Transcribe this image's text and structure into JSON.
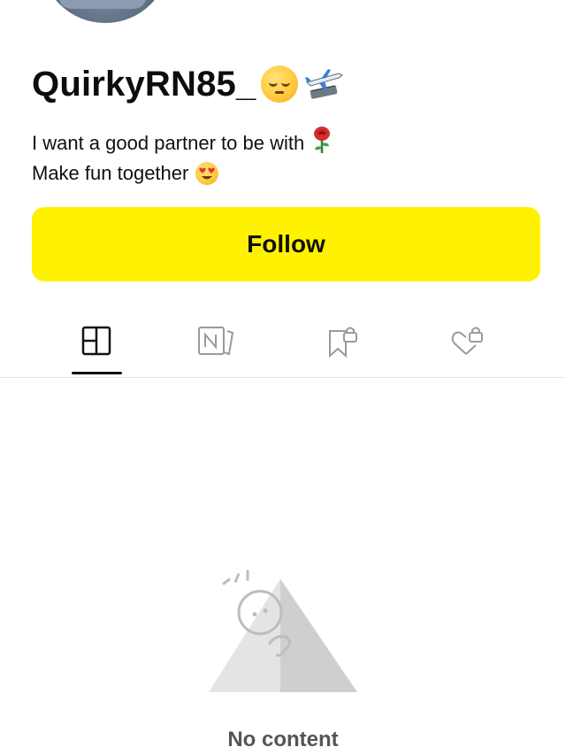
{
  "profile": {
    "username": "QuirkyRN85_",
    "username_emojis": [
      "pensive-face-emoji",
      "airplane-emoji"
    ],
    "bio_line1": "I want a good partner to be with",
    "bio_line1_emoji": "rose-emoji",
    "bio_line2": "Make fun together",
    "bio_line2_emoji": "heart-eyes-emoji"
  },
  "follow_button": {
    "label": "Follow",
    "color": "#fff200"
  },
  "tabs": [
    {
      "icon": "grid-icon",
      "active": true
    },
    {
      "icon": "notes-icon",
      "active": false
    },
    {
      "icon": "locked-bookmark-icon",
      "active": false
    },
    {
      "icon": "locked-heart-icon",
      "active": false
    }
  ],
  "empty_state": {
    "text": "No content",
    "illustration": "empty-triangle-face-icon"
  }
}
